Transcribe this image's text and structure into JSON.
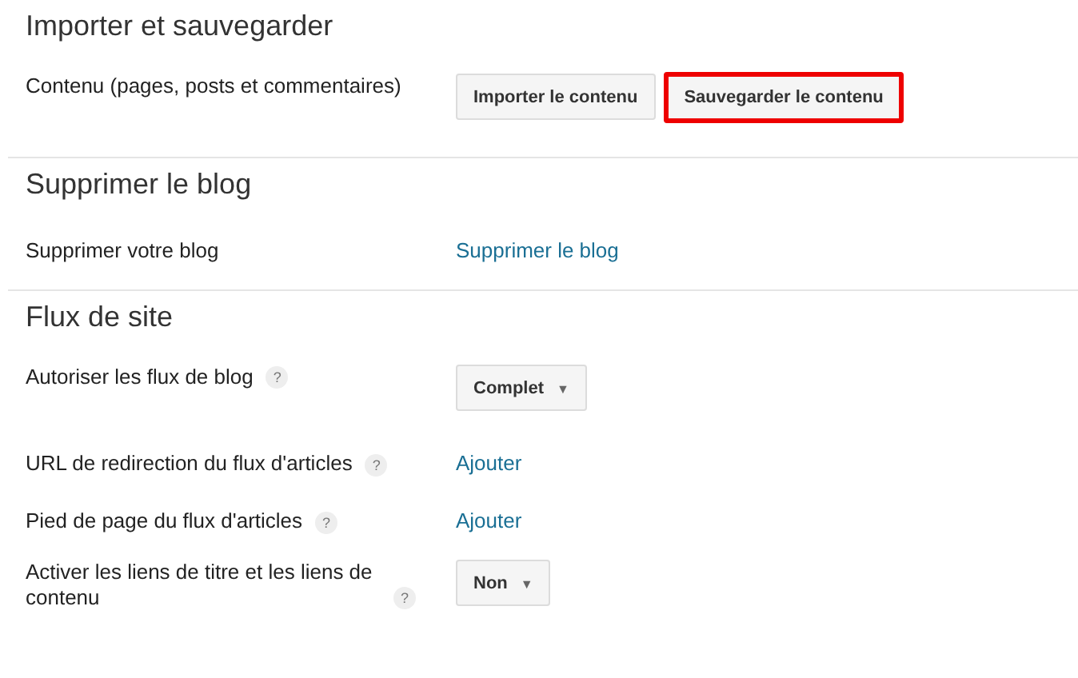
{
  "sections": [
    {
      "title": "Importer et sauvegarder",
      "rows": [
        {
          "label": "Contenu (pages, posts et commentaires)",
          "kind": "buttons",
          "buttons": [
            {
              "label": "Importer le contenu",
              "highlighted": false
            },
            {
              "label": "Sauvegarder le contenu",
              "highlighted": true
            }
          ]
        }
      ]
    },
    {
      "title": "Supprimer le blog",
      "rows": [
        {
          "label": "Supprimer votre blog",
          "kind": "link",
          "link": "Supprimer le blog"
        }
      ]
    },
    {
      "title": "Flux de site",
      "rows": [
        {
          "label": "Autoriser les flux de blog",
          "help": "?",
          "kind": "dropdown",
          "value": "Complet",
          "caret": "▼"
        },
        {
          "label": "URL de redirection du flux d'articles",
          "help": "?",
          "kind": "link",
          "link": "Ajouter"
        },
        {
          "label": "Pied de page du flux d'articles",
          "help": "?",
          "kind": "link",
          "link": "Ajouter"
        },
        {
          "label": "Activer les liens de titre et les liens de contenu",
          "help": "?",
          "kind": "dropdown",
          "value": "Non",
          "caret": "▼"
        }
      ]
    }
  ]
}
